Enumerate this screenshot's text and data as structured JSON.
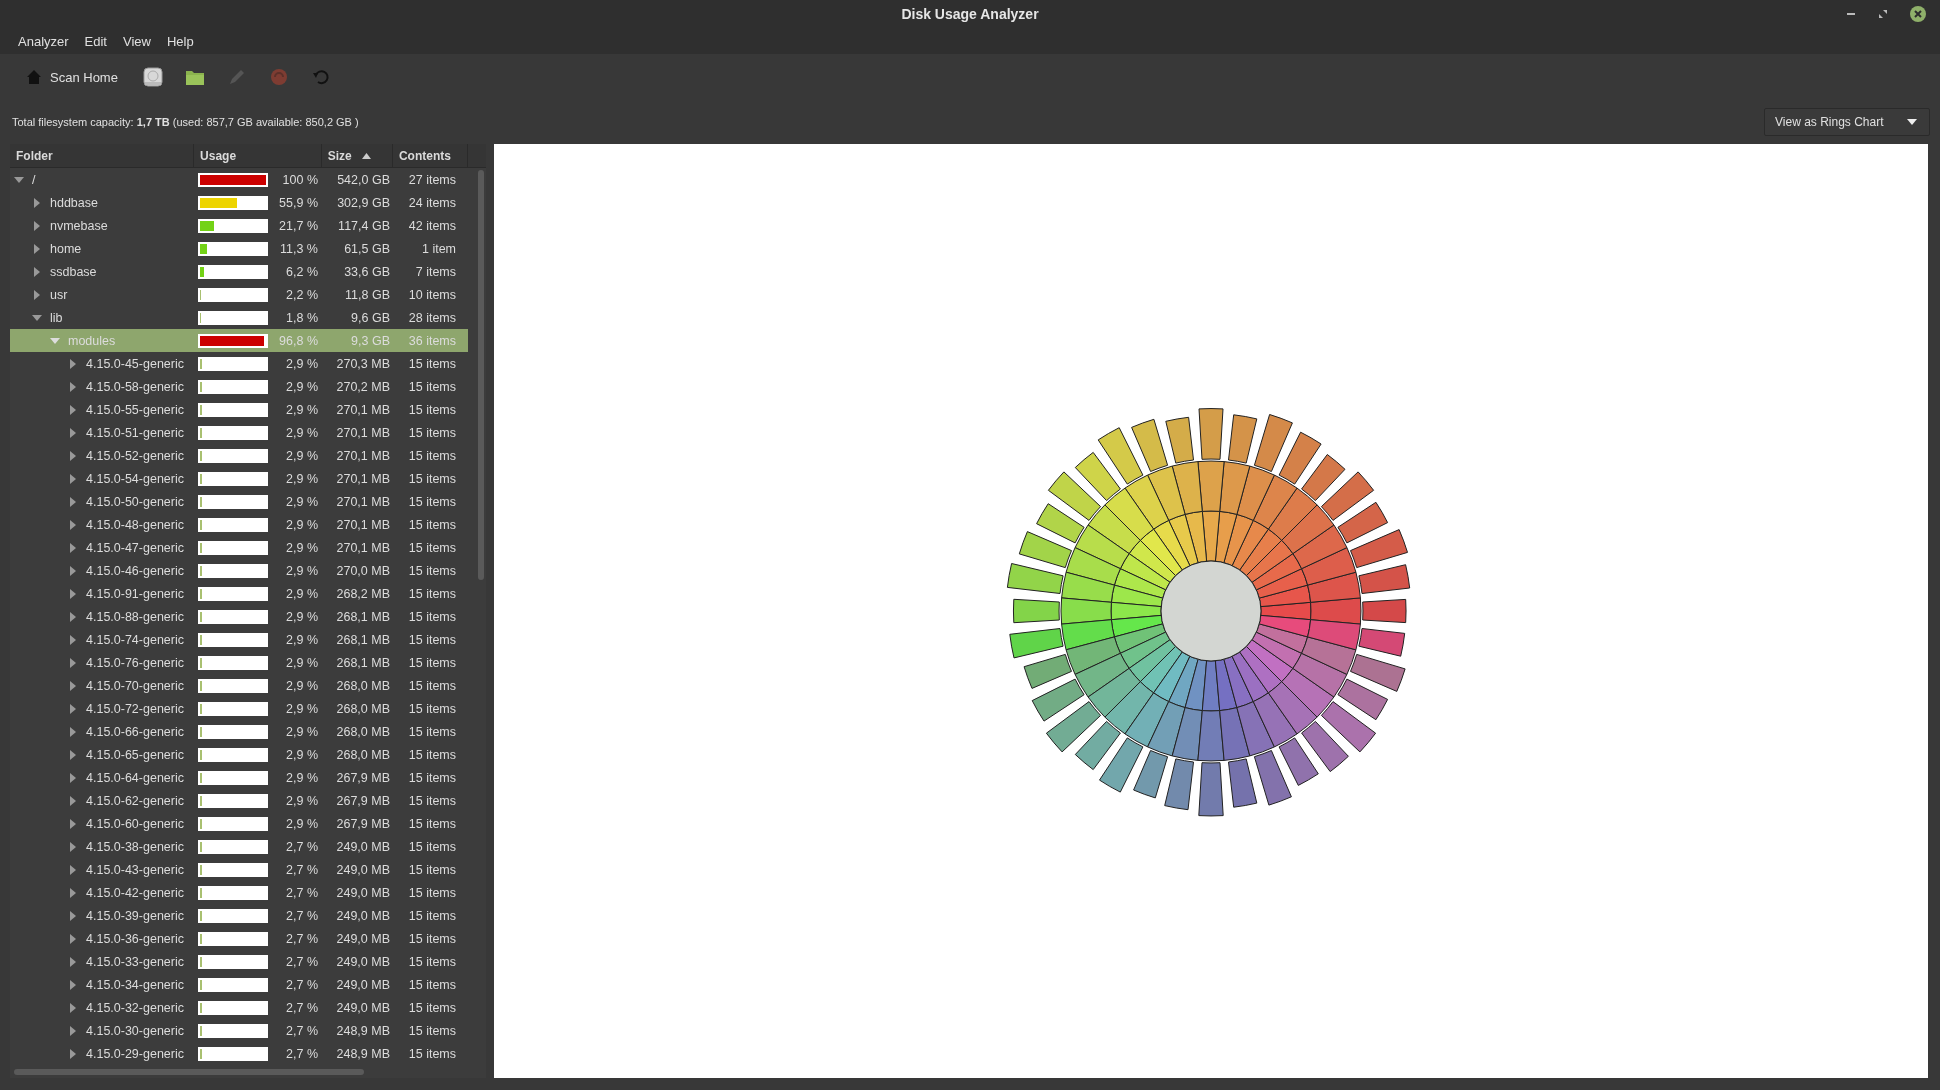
{
  "window": {
    "title": "Disk Usage Analyzer"
  },
  "menu": [
    "Analyzer",
    "Edit",
    "View",
    "Help"
  ],
  "toolbar": [
    {
      "kind": "home",
      "label": "Scan Home",
      "disabled": false
    },
    {
      "kind": "drive",
      "disabled": false
    },
    {
      "kind": "folder",
      "disabled": false
    },
    {
      "kind": "pencil",
      "disabled": true
    },
    {
      "kind": "stop",
      "disabled": true
    },
    {
      "kind": "refresh",
      "disabled": false
    }
  ],
  "capacity": "Total filesystem capacity: **1,7 TB** (used: 857,7 GB available: 850,2 GB )",
  "view_selector": {
    "value": "View as Rings Chart"
  },
  "table": {
    "columns": [
      {
        "label": "Folder",
        "sorted": false
      },
      {
        "label": "Usage",
        "sorted": false
      },
      {
        "label": "Size",
        "sorted": true
      },
      {
        "label": "Contents",
        "sorted": false
      }
    ],
    "rows": [
      {
        "name": "/",
        "level": 1.0,
        "percent": "100 %",
        "size": "542,0 GB",
        "contents": "27 items",
        "expanded": true,
        "selected": false,
        "children": [
          {
            "name": "hddbase",
            "level": 0.559,
            "percent": "55,9 %",
            "size": "302,9 GB",
            "contents": "24 items",
            "expanded": false,
            "selected": false
          },
          {
            "name": "nvmebase",
            "level": 0.217,
            "percent": "21,7 %",
            "size": "117,4 GB",
            "contents": "42 items",
            "expanded": false,
            "selected": false
          },
          {
            "name": "home",
            "level": 0.113,
            "percent": "11,3 %",
            "size": "61,5 GB",
            "contents": "1 item",
            "expanded": false,
            "selected": false
          },
          {
            "name": "ssdbase",
            "level": 0.062,
            "percent": "6,2 %",
            "size": "33,6 GB",
            "contents": "7 items",
            "expanded": false,
            "selected": false
          },
          {
            "name": "usr",
            "level": 0.022,
            "percent": "2,2 %",
            "size": "11,8 GB",
            "contents": "10 items",
            "expanded": false,
            "selected": false
          },
          {
            "name": "lib",
            "level": 0.018,
            "percent": "1,8 %",
            "size": "9,6 GB",
            "contents": "28 items",
            "expanded": true,
            "selected": false,
            "children": [
              {
                "name": "modules",
                "level": 0.968,
                "percent": "96,8 %",
                "size": "9,3 GB",
                "contents": "36 items",
                "expanded": true,
                "selected": true,
                "children": [
                  {
                    "name": "4.15.0-45-generic",
                    "level": 0.029,
                    "percent": "2,9 %",
                    "size": "270,3 MB",
                    "contents": "15 items",
                    "expanded": false,
                    "selected": false
                  },
                  {
                    "name": "4.15.0-58-generic",
                    "level": 0.029,
                    "percent": "2,9 %",
                    "size": "270,2 MB",
                    "contents": "15 items",
                    "expanded": false,
                    "selected": false
                  },
                  {
                    "name": "4.15.0-55-generic",
                    "level": 0.029,
                    "percent": "2,9 %",
                    "size": "270,1 MB",
                    "contents": "15 items",
                    "expanded": false,
                    "selected": false
                  },
                  {
                    "name": "4.15.0-51-generic",
                    "level": 0.029,
                    "percent": "2,9 %",
                    "size": "270,1 MB",
                    "contents": "15 items",
                    "expanded": false,
                    "selected": false
                  },
                  {
                    "name": "4.15.0-52-generic",
                    "level": 0.029,
                    "percent": "2,9 %",
                    "size": "270,1 MB",
                    "contents": "15 items",
                    "expanded": false,
                    "selected": false
                  },
                  {
                    "name": "4.15.0-54-generic",
                    "level": 0.029,
                    "percent": "2,9 %",
                    "size": "270,1 MB",
                    "contents": "15 items",
                    "expanded": false,
                    "selected": false
                  },
                  {
                    "name": "4.15.0-50-generic",
                    "level": 0.029,
                    "percent": "2,9 %",
                    "size": "270,1 MB",
                    "contents": "15 items",
                    "expanded": false,
                    "selected": false
                  },
                  {
                    "name": "4.15.0-48-generic",
                    "level": 0.029,
                    "percent": "2,9 %",
                    "size": "270,1 MB",
                    "contents": "15 items",
                    "expanded": false,
                    "selected": false
                  },
                  {
                    "name": "4.15.0-47-generic",
                    "level": 0.029,
                    "percent": "2,9 %",
                    "size": "270,1 MB",
                    "contents": "15 items",
                    "expanded": false,
                    "selected": false
                  },
                  {
                    "name": "4.15.0-46-generic",
                    "level": 0.029,
                    "percent": "2,9 %",
                    "size": "270,0 MB",
                    "contents": "15 items",
                    "expanded": false,
                    "selected": false
                  },
                  {
                    "name": "4.15.0-91-generic",
                    "level": 0.029,
                    "percent": "2,9 %",
                    "size": "268,2 MB",
                    "contents": "15 items",
                    "expanded": false,
                    "selected": false
                  },
                  {
                    "name": "4.15.0-88-generic",
                    "level": 0.029,
                    "percent": "2,9 %",
                    "size": "268,1 MB",
                    "contents": "15 items",
                    "expanded": false,
                    "selected": false
                  },
                  {
                    "name": "4.15.0-74-generic",
                    "level": 0.029,
                    "percent": "2,9 %",
                    "size": "268,1 MB",
                    "contents": "15 items",
                    "expanded": false,
                    "selected": false
                  },
                  {
                    "name": "4.15.0-76-generic",
                    "level": 0.029,
                    "percent": "2,9 %",
                    "size": "268,1 MB",
                    "contents": "15 items",
                    "expanded": false,
                    "selected": false
                  },
                  {
                    "name": "4.15.0-70-generic",
                    "level": 0.029,
                    "percent": "2,9 %",
                    "size": "268,0 MB",
                    "contents": "15 items",
                    "expanded": false,
                    "selected": false
                  },
                  {
                    "name": "4.15.0-72-generic",
                    "level": 0.029,
                    "percent": "2,9 %",
                    "size": "268,0 MB",
                    "contents": "15 items",
                    "expanded": false,
                    "selected": false
                  },
                  {
                    "name": "4.15.0-66-generic",
                    "level": 0.029,
                    "percent": "2,9 %",
                    "size": "268,0 MB",
                    "contents": "15 items",
                    "expanded": false,
                    "selected": false
                  },
                  {
                    "name": "4.15.0-65-generic",
                    "level": 0.029,
                    "percent": "2,9 %",
                    "size": "268,0 MB",
                    "contents": "15 items",
                    "expanded": false,
                    "selected": false
                  },
                  {
                    "name": "4.15.0-64-generic",
                    "level": 0.029,
                    "percent": "2,9 %",
                    "size": "267,9 MB",
                    "contents": "15 items",
                    "expanded": false,
                    "selected": false
                  },
                  {
                    "name": "4.15.0-62-generic",
                    "level": 0.029,
                    "percent": "2,9 %",
                    "size": "267,9 MB",
                    "contents": "15 items",
                    "expanded": false,
                    "selected": false
                  },
                  {
                    "name": "4.15.0-60-generic",
                    "level": 0.029,
                    "percent": "2,9 %",
                    "size": "267,9 MB",
                    "contents": "15 items",
                    "expanded": false,
                    "selected": false
                  },
                  {
                    "name": "4.15.0-38-generic",
                    "level": 0.027,
                    "percent": "2,7 %",
                    "size": "249,0 MB",
                    "contents": "15 items",
                    "expanded": false,
                    "selected": false
                  },
                  {
                    "name": "4.15.0-43-generic",
                    "level": 0.027,
                    "percent": "2,7 %",
                    "size": "249,0 MB",
                    "contents": "15 items",
                    "expanded": false,
                    "selected": false
                  },
                  {
                    "name": "4.15.0-42-generic",
                    "level": 0.027,
                    "percent": "2,7 %",
                    "size": "249,0 MB",
                    "contents": "15 items",
                    "expanded": false,
                    "selected": false
                  },
                  {
                    "name": "4.15.0-39-generic",
                    "level": 0.027,
                    "percent": "2,7 %",
                    "size": "249,0 MB",
                    "contents": "15 items",
                    "expanded": false,
                    "selected": false
                  },
                  {
                    "name": "4.15.0-36-generic",
                    "level": 0.027,
                    "percent": "2,7 %",
                    "size": "249,0 MB",
                    "contents": "15 items",
                    "expanded": false,
                    "selected": false
                  },
                  {
                    "name": "4.15.0-33-generic",
                    "level": 0.027,
                    "percent": "2,7 %",
                    "size": "249,0 MB",
                    "contents": "15 items",
                    "expanded": false,
                    "selected": false
                  },
                  {
                    "name": "4.15.0-34-generic",
                    "level": 0.027,
                    "percent": "2,7 %",
                    "size": "249,0 MB",
                    "contents": "15 items",
                    "expanded": false,
                    "selected": false
                  },
                  {
                    "name": "4.15.0-32-generic",
                    "level": 0.027,
                    "percent": "2,7 %",
                    "size": "249,0 MB",
                    "contents": "15 items",
                    "expanded": false,
                    "selected": false
                  },
                  {
                    "name": "4.15.0-30-generic",
                    "level": 0.027,
                    "percent": "2,7 %",
                    "size": "248,9 MB",
                    "contents": "15 items",
                    "expanded": false,
                    "selected": false
                  },
                  {
                    "name": "4.15.0-29-generic",
                    "level": 0.027,
                    "percent": "2,7 %",
                    "size": "248,9 MB",
                    "contents": "15 items",
                    "expanded": false,
                    "selected": false
                  }
                ]
              }
            ]
          }
        ]
      }
    ]
  }
}
